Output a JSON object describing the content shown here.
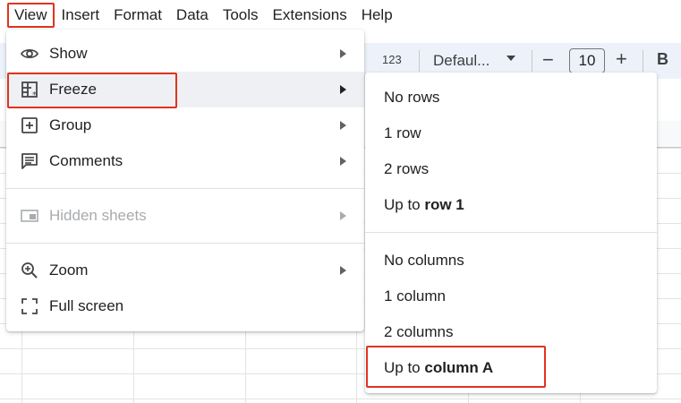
{
  "menubar": {
    "items": [
      "View",
      "Insert",
      "Format",
      "Data",
      "Tools",
      "Extensions",
      "Help"
    ]
  },
  "toolbar": {
    "number_format_label": "123",
    "font_label": "Defaul...",
    "minus_label": "−",
    "font_size": "10",
    "plus_label": "+",
    "bold_label": "B"
  },
  "view_menu": {
    "items": [
      {
        "label": "Show",
        "icon": "eye-icon"
      },
      {
        "label": "Freeze",
        "icon": "freeze-grid-icon"
      },
      {
        "label": "Group",
        "icon": "plus-box-icon"
      },
      {
        "label": "Comments",
        "icon": "comment-icon"
      },
      {
        "label": "Hidden sheets",
        "icon": "hidden-sheet-icon"
      },
      {
        "label": "Zoom",
        "icon": "zoom-in-icon"
      },
      {
        "label": "Full screen",
        "icon": "fullscreen-icon"
      }
    ]
  },
  "freeze_menu": {
    "rows": [
      {
        "label": "No rows"
      },
      {
        "label": "1 row"
      },
      {
        "label": "2 rows"
      },
      {
        "prefix": "Up to ",
        "bold": "row 1"
      }
    ],
    "columns": [
      {
        "label": "No columns"
      },
      {
        "label": "1 column"
      },
      {
        "label": "2 columns"
      },
      {
        "prefix": "Up to ",
        "bold": "column A"
      }
    ]
  },
  "colors": {
    "highlight_box": "#e0341e",
    "hover_bg": "#eef0f3",
    "disabled_text": "#a8abae"
  }
}
